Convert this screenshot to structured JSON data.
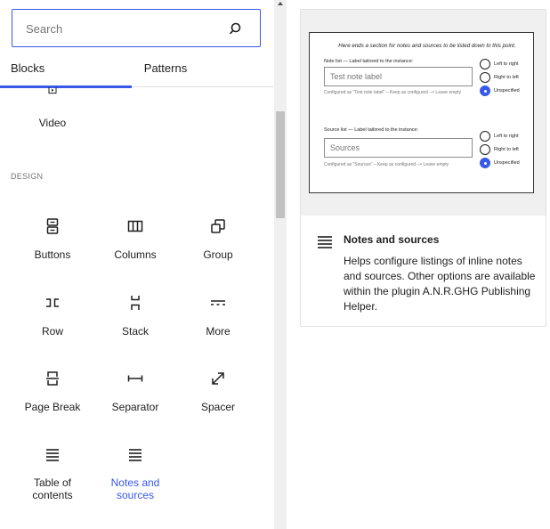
{
  "search": {
    "placeholder": "Search"
  },
  "tabs": [
    {
      "label": "Blocks"
    },
    {
      "label": "Patterns"
    }
  ],
  "blocks_above": {
    "video": "Video"
  },
  "category": "DESIGN",
  "blocks": {
    "buttons": "Buttons",
    "columns": "Columns",
    "group": "Group",
    "row": "Row",
    "stack": "Stack",
    "more": "More",
    "page_break": "Page Break",
    "separator": "Separator",
    "spacer": "Spacer",
    "toc_line1": "Table of",
    "toc_line2": "contents",
    "notes_line1": "Notes and",
    "notes_line2": "sources"
  },
  "preview": {
    "intro": "Here ends a section for notes and sources to be listed down to this point.",
    "note_label": "Note list — Label tailored to the instance:",
    "note_value": "Test note label",
    "note_hint": "Configured as \"Test note label\" – Keep as configured –> Leave empty",
    "source_label": "Source list — Label tailored to the instance:",
    "source_value": "Sources",
    "source_hint": "Configured as \"Sources\" – Keep as configured –> Leave empty",
    "radio_options": [
      "Left to right",
      "Right to left",
      "Unspecified"
    ],
    "radio_selected": "Unspecified",
    "title": "Notes and sources",
    "description": "Helps configure listings of inline notes and sources. Other options are available within the plugin A.N.R.GHG Publishing Helper."
  },
  "colors": {
    "accent": "#3858e9",
    "text": "#1e1e1e",
    "muted": "#757575",
    "preview_bg": "#f0f0f0"
  },
  "icons": [
    "search-icon",
    "video-icon",
    "buttons-icon",
    "columns-icon",
    "group-icon",
    "row-icon",
    "stack-icon",
    "more-icon",
    "page-break-icon",
    "separator-icon",
    "spacer-icon",
    "list-icon"
  ]
}
